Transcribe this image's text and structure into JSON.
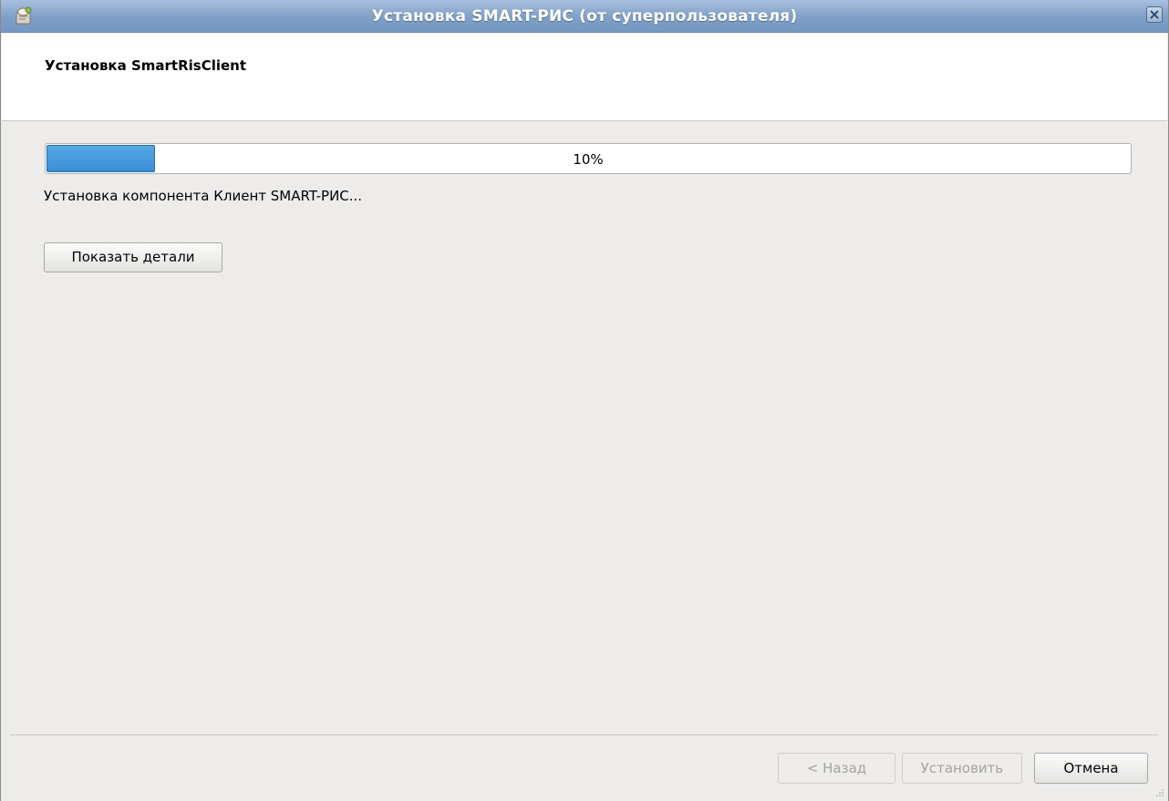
{
  "window": {
    "title": "Установка SMART-РИС (от суперпользователя)",
    "title_bar_color": "#7f9fc7"
  },
  "header": {
    "title": "Установка SmartRisClient"
  },
  "progress": {
    "value_percent": 10,
    "label": "10%",
    "fill_color": "#3a8fd6"
  },
  "status": {
    "text": "Установка компонента Клиент SMART-РИС..."
  },
  "buttons": {
    "show_details": "Показать детали",
    "back": "< Назад",
    "install": "Установить",
    "cancel": "Отмена"
  },
  "icons": {
    "app": "installer-icon",
    "close": "close-icon",
    "resize": "resize-grip-icon"
  }
}
